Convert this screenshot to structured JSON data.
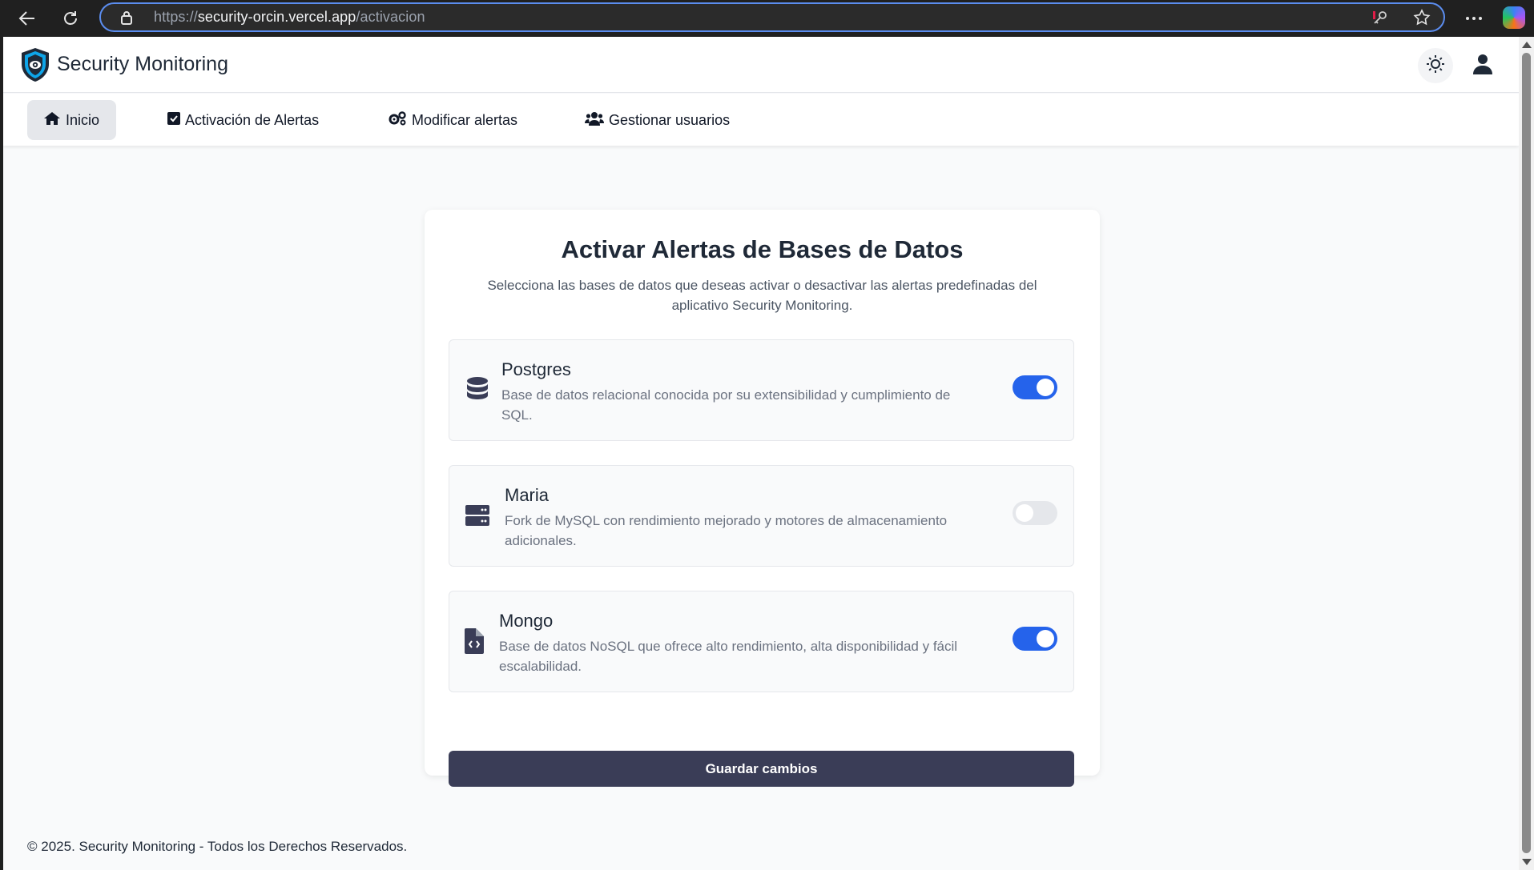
{
  "browser": {
    "url_scheme": "https://",
    "url_host": "security-orcin.vercel.app",
    "url_path": "/activacion"
  },
  "header": {
    "title": "Security Monitoring"
  },
  "nav": {
    "items": [
      {
        "label": "Inicio",
        "icon": "home-icon",
        "active": true
      },
      {
        "label": "Activación de Alertas",
        "icon": "checkbox-icon",
        "active": false
      },
      {
        "label": "Modificar alertas",
        "icon": "gears-icon",
        "active": false
      },
      {
        "label": "Gestionar usuarios",
        "icon": "users-icon",
        "active": false
      }
    ]
  },
  "card": {
    "title": "Activar Alertas de Bases de Datos",
    "description": "Selecciona las bases de datos que deseas activar o desactivar las alertas predefinadas del aplicativo Security Monitoring.",
    "databases": [
      {
        "name": "Postgres",
        "description": "Base de datos relacional conocida por su extensibilidad y cumplimiento de SQL.",
        "icon": "database-icon",
        "enabled": true
      },
      {
        "name": "Maria",
        "description": "Fork de MySQL con rendimiento mejorado y motores de almacenamiento adicionales.",
        "icon": "server-icon",
        "enabled": false
      },
      {
        "name": "Mongo",
        "description": "Base de datos NoSQL que ofrece alto rendimiento, alta disponibilidad y fácil escalabilidad.",
        "icon": "file-code-icon",
        "enabled": true
      }
    ],
    "save_label": "Guardar cambios"
  },
  "footer": {
    "text": "© 2025. Security Monitoring - Todos los Derechos Reservados."
  },
  "colors": {
    "toggle_on": "#2563eb",
    "toggle_off": "#e5e7eb",
    "primary_button": "#3a3d57"
  }
}
